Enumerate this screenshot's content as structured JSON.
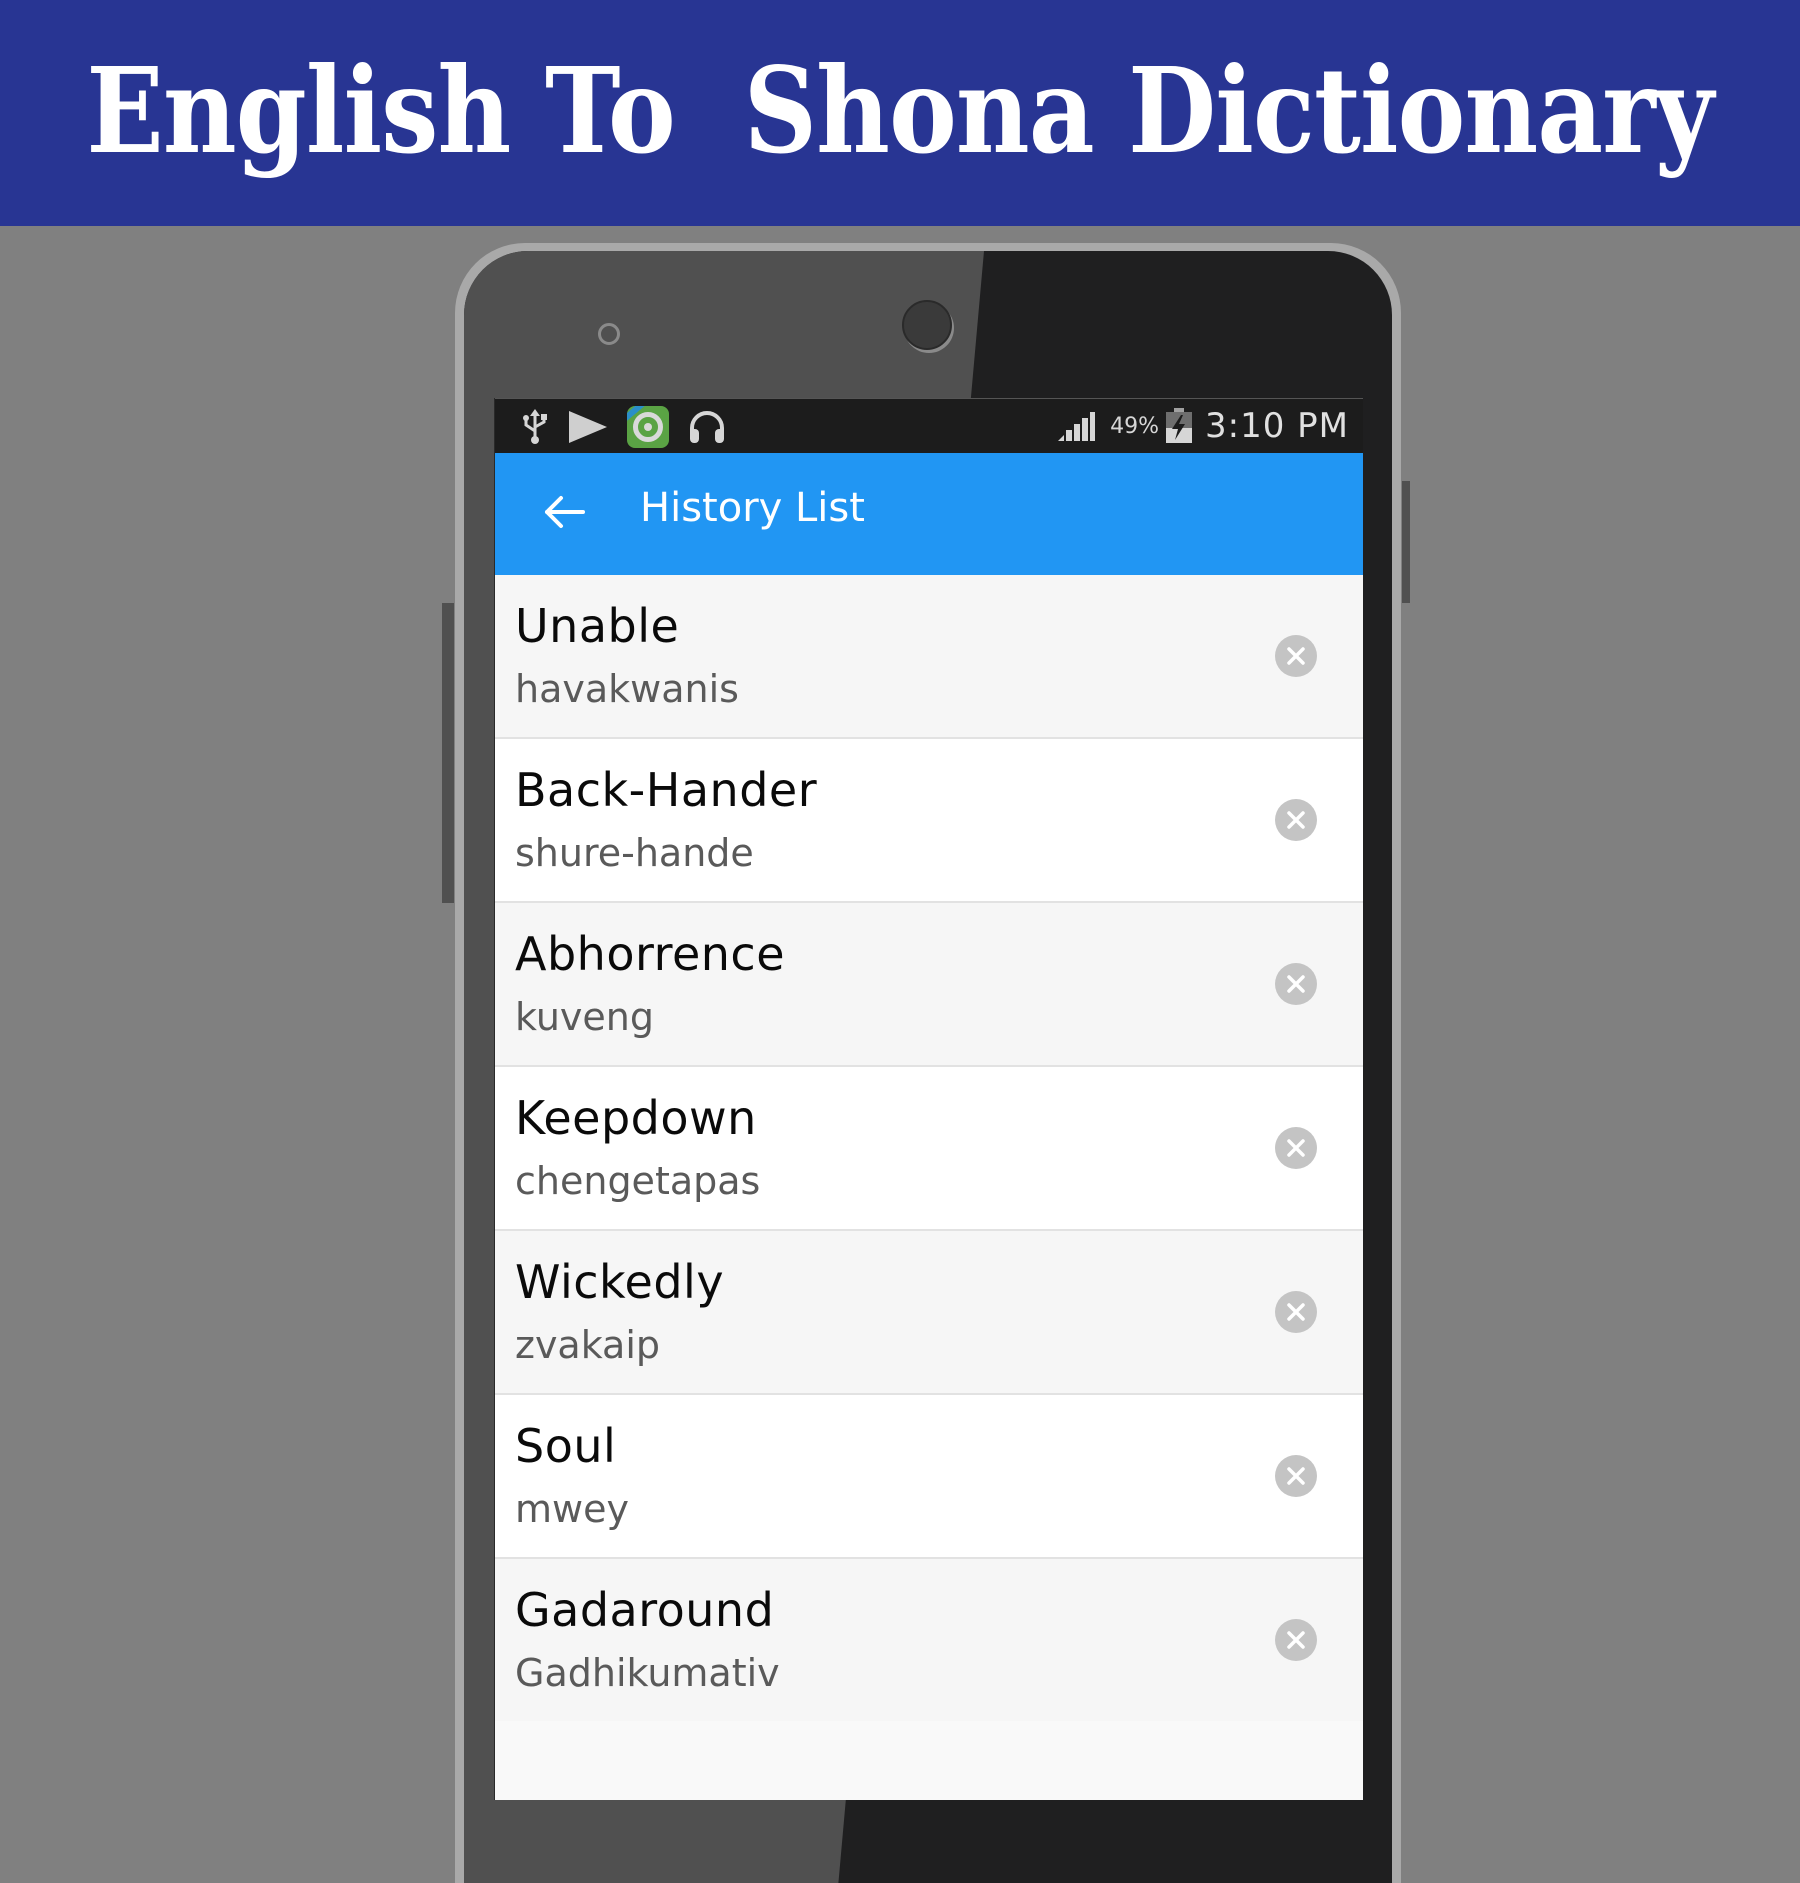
{
  "banner": {
    "title": "English To  Shona Dictionary"
  },
  "status_bar": {
    "left_icons": [
      "usb-icon",
      "play-store-icon",
      "green-app-icon",
      "headphones-icon"
    ],
    "right_icons": [
      "signal-icon",
      "battery-charging-icon"
    ],
    "battery_percent": "49%",
    "time": "3:10 PM"
  },
  "app_bar": {
    "back_icon": "arrow-left-icon",
    "title": "History List"
  },
  "history": {
    "items": [
      {
        "word": "Unable",
        "translation": "havakwanis"
      },
      {
        "word": "Back-Hander",
        "translation": "shure-hande"
      },
      {
        "word": "Abhorrence",
        "translation": "kuveng"
      },
      {
        "word": "Keepdown",
        "translation": "chengetapas"
      },
      {
        "word": "Wickedly",
        "translation": "zvakaip"
      },
      {
        "word": "Soul",
        "translation": "mwey"
      },
      {
        "word": "Gadaround",
        "translation": "Gadhikumativ"
      }
    ],
    "delete_icon": "close-circle-icon"
  },
  "colors": {
    "banner": "#283593",
    "background": "#808080",
    "app_bar": "#2196F3",
    "status_bar": "#1C1C1C",
    "row_alt": "#F6F6F6",
    "row": "#FFFFFF",
    "delete_icon": "#C4C4C4"
  }
}
